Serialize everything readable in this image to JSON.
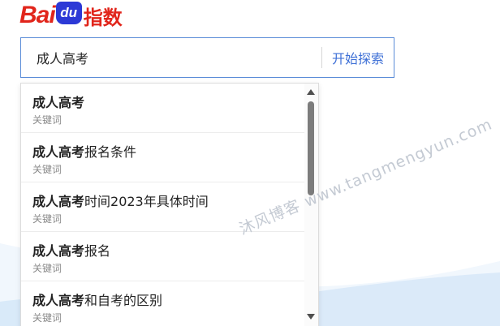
{
  "logo": {
    "text_bai": "Bai",
    "text_du": "du",
    "text_cn": "指数"
  },
  "search": {
    "value": "成人高考",
    "button_label": "开始探索"
  },
  "suggestions": [
    {
      "bold": "成人高考",
      "rest": "",
      "type": "关键词"
    },
    {
      "bold": "成人高考",
      "rest": "报名条件",
      "type": "关键词"
    },
    {
      "bold": "成人高考",
      "rest": "时间2023年具体时间",
      "type": "关键词"
    },
    {
      "bold": "成人高考",
      "rest": "报名",
      "type": "关键词"
    },
    {
      "bold": "成人高考",
      "rest": "和自考的区别",
      "type": "关键词"
    }
  ],
  "watermark": "沐风博客 www.tangmengyun.com",
  "colors": {
    "brand_red": "#e1251b",
    "brand_blue": "#2c39d6",
    "accent_blue": "#3d6fd6",
    "wave_light": "#e7f1fb",
    "wave_mid": "#d3e6f8"
  }
}
